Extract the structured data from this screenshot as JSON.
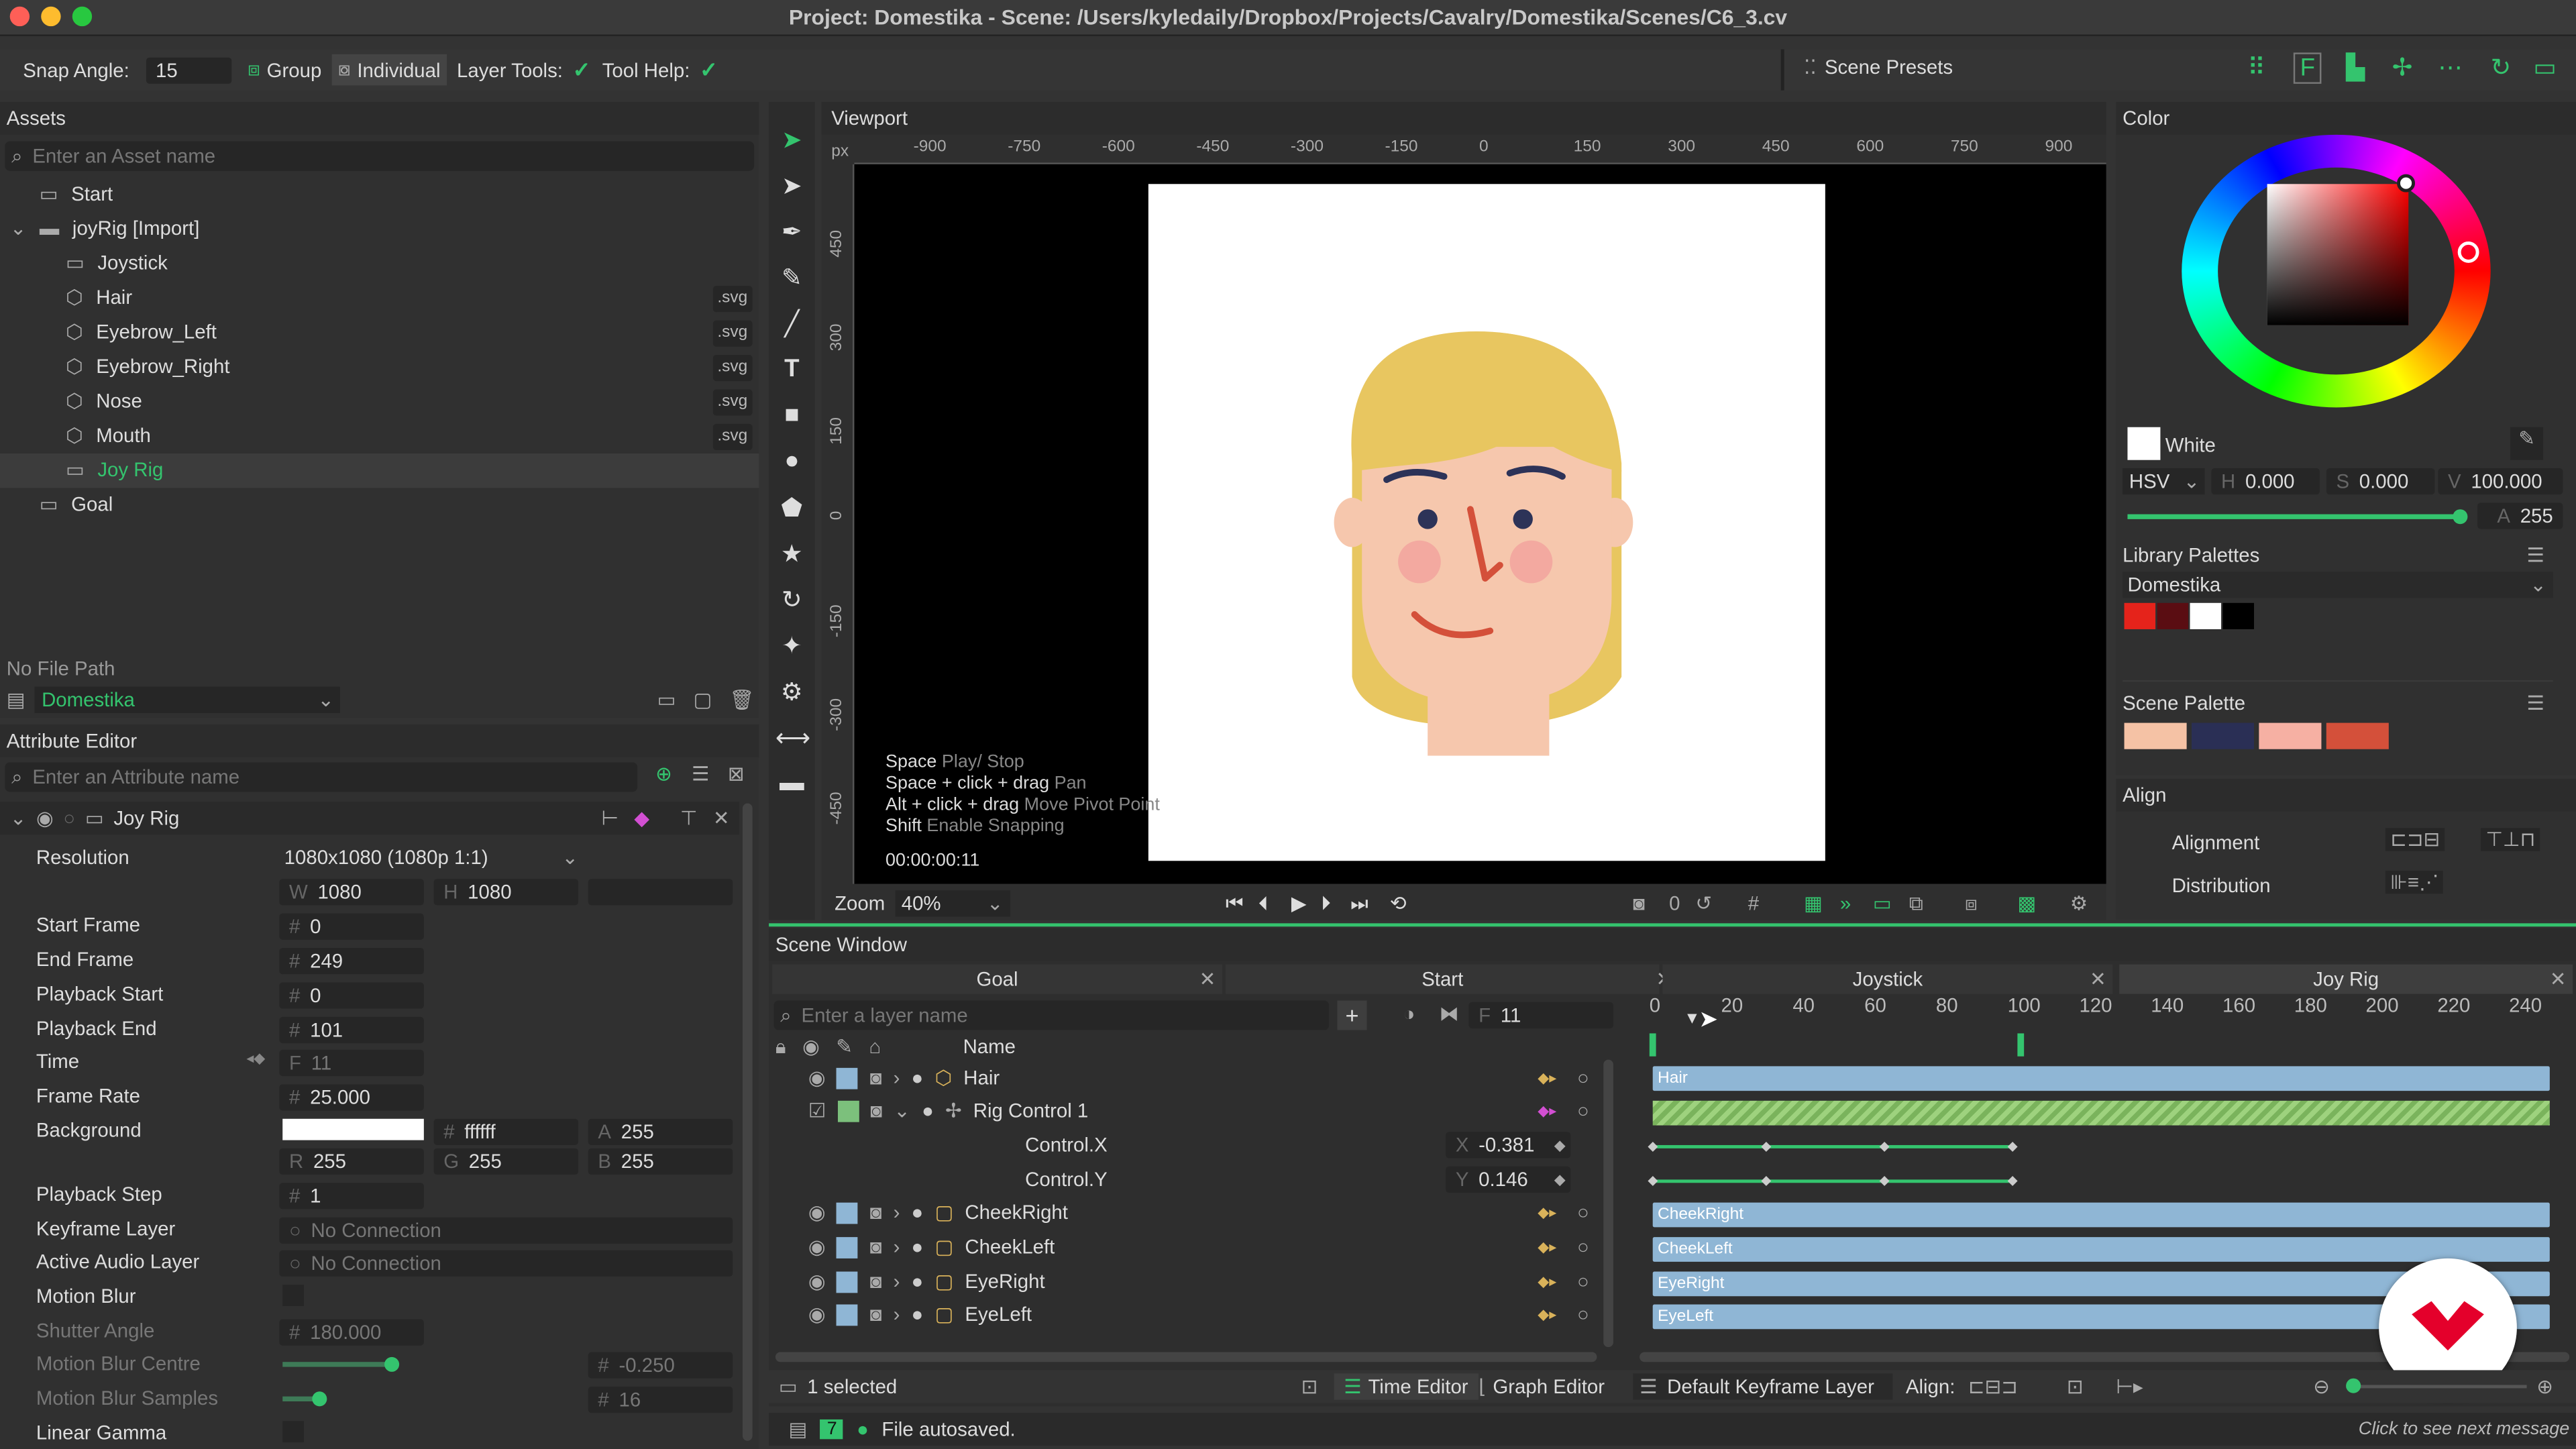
{
  "window": {
    "title": "Project: Domestika - Scene: /Users/kyledaily/Dropbox/Projects/Cavalry/Domestika/Scenes/C6_3.cv"
  },
  "toolbar": {
    "snap_angle_label": "Snap Angle:",
    "snap_angle_value": "15",
    "group": "Group",
    "individual": "Individual",
    "layer_tools": "Layer Tools:",
    "tool_help": "Tool Help:",
    "scene_presets": "Scene Presets"
  },
  "assets": {
    "header": "Assets",
    "search_placeholder": "Enter an Asset name",
    "items": [
      {
        "label": "Start",
        "badge": ""
      },
      {
        "label": "joyRig [Import]",
        "badge": ""
      },
      {
        "label": "Joystick",
        "badge": ""
      },
      {
        "label": "Hair",
        "badge": ".svg"
      },
      {
        "label": "Eyebrow_Left",
        "badge": ".svg"
      },
      {
        "label": "Eyebrow_Right",
        "badge": ".svg"
      },
      {
        "label": "Nose",
        "badge": ".svg"
      },
      {
        "label": "Mouth",
        "badge": ".svg"
      },
      {
        "label": "Joy Rig",
        "badge": ""
      },
      {
        "label": "Goal",
        "badge": ""
      }
    ],
    "file_path": "No File Path",
    "project": "Domestika"
  },
  "attr": {
    "header": "Attribute Editor",
    "search_placeholder": "Enter an Attribute name",
    "layer_name": "Joy Rig",
    "resolution_label": "Resolution",
    "resolution_value": "1080x1080 (1080p 1:1)",
    "w": "1080",
    "h": "1080",
    "start_frame_label": "Start Frame",
    "start_frame": "0",
    "end_frame_label": "End Frame",
    "end_frame": "249",
    "pb_start_label": "Playback Start",
    "pb_start": "0",
    "pb_end_label": "Playback End",
    "pb_end": "101",
    "time_label": "Time",
    "time": "11",
    "frame_rate_label": "Frame Rate",
    "frame_rate": "25.000",
    "bg_label": "Background",
    "bg_hex": "ffffff",
    "bg_a": "255",
    "bg_r": "255",
    "bg_g": "255",
    "bg_b": "255",
    "pb_step_label": "Playback Step",
    "pb_step": "1",
    "kf_layer_label": "Keyframe Layer",
    "kf_layer": "No Connection",
    "audio_label": "Active Audio Layer",
    "audio": "No Connection",
    "mb_label": "Motion Blur",
    "shutter_label": "Shutter Angle",
    "shutter": "180.000",
    "mbc_label": "Motion Blur Centre",
    "mbc": "-0.250",
    "mbs_label": "Motion Blur Samples",
    "mbs": "16",
    "gamma_label": "Linear Gamma"
  },
  "viewport": {
    "header": "Viewport",
    "unit": "px",
    "hticks": [
      "-900",
      "-750",
      "-600",
      "-450",
      "-300",
      "-150",
      "0",
      "150",
      "300",
      "450",
      "600",
      "750",
      "900"
    ],
    "vticks": [
      "450",
      "300",
      "150",
      "0",
      "-150",
      "-300",
      "-450"
    ],
    "help": [
      {
        "key": "Space",
        "desc": "Play/ Stop"
      },
      {
        "key": "Space + click + drag",
        "desc": "Pan"
      },
      {
        "key": "Alt + click + drag",
        "desc": "Move Pivot Point"
      },
      {
        "key": "Shift",
        "desc": "Enable Snapping"
      }
    ],
    "timecode": "00:00:00:11",
    "zoom_label": "Zoom",
    "zoom": "40%",
    "frame": "0"
  },
  "color": {
    "header": "Color",
    "name": "White",
    "mode": "HSV",
    "h": "0.000",
    "s": "0.000",
    "v": "100.000",
    "a": "255",
    "library_label": "Library Palettes",
    "library": "Domestika",
    "library_swatches": [
      "#e5231b",
      "#5a0d12",
      "#ffffff",
      "#000000"
    ],
    "scene_label": "Scene Palette",
    "scene_swatches": [
      "#f5c2a5",
      "#2a2f55",
      "#f6b0a3",
      "#d4503a"
    ]
  },
  "align": {
    "header": "Align",
    "alignment": "Alignment",
    "distribution": "Distribution"
  },
  "scene": {
    "header": "Scene Window",
    "tabs": [
      "Goal",
      "Start",
      "Joystick",
      "Joy Rig"
    ],
    "layer_placeholder": "Enter a layer name",
    "frame": "11",
    "name_col": "Name",
    "layers": [
      {
        "name": "Hair"
      },
      {
        "name": "Rig Control 1"
      },
      {
        "name": "Control.X",
        "axis": "X",
        "value": "-0.381"
      },
      {
        "name": "Control.Y",
        "axis": "Y",
        "value": "0.146"
      },
      {
        "name": "CheekRight"
      },
      {
        "name": "CheekLeft"
      },
      {
        "name": "EyeRight"
      },
      {
        "name": "EyeLeft"
      }
    ],
    "ticks": [
      "0",
      "20",
      "40",
      "60",
      "80",
      "100",
      "120",
      "140",
      "160",
      "180",
      "200",
      "220",
      "240"
    ],
    "bars": [
      "Hair",
      "CheekRight",
      "CheekLeft",
      "EyeRight",
      "EyeLeft"
    ],
    "selected": "1 selected",
    "time_editor": "Time Editor",
    "graph_editor": "Graph Editor",
    "kf_layer": "Default Keyframe Layer",
    "align_label": "Align:"
  },
  "status": {
    "count": "7",
    "message": "File autosaved.",
    "hint": "Click to see next message"
  },
  "colors": {
    "accent": "#34c46e",
    "bar": "#8fb6d5",
    "canvas_bg": "#000000"
  }
}
